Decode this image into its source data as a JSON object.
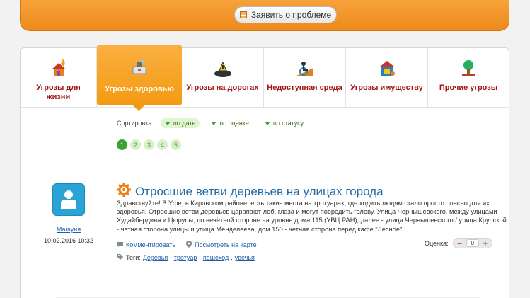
{
  "header": {
    "report_button": "Заявить о проблеме"
  },
  "tabs": [
    {
      "label": "Угрозы для жизни",
      "icon": "fire-house-icon"
    },
    {
      "label": "Угрозы здоровью",
      "icon": "health-threat-icon",
      "active": true
    },
    {
      "label": "Угрозы на дорогах",
      "icon": "road-threat-icon"
    },
    {
      "label": "Недоступная среда",
      "icon": "wheelchair-ramp-icon"
    },
    {
      "label": "Угрозы имуществу",
      "icon": "property-threat-icon"
    },
    {
      "label": "Прочие угрозы",
      "icon": "tree-threat-icon"
    }
  ],
  "sort": {
    "label": "Сортировка:",
    "options": [
      "по дате",
      "по оценке",
      "по статусу"
    ],
    "active": "по дате"
  },
  "pager": {
    "pages": [
      "1",
      "2",
      "3",
      "4",
      "5"
    ],
    "current": "1"
  },
  "post": {
    "author": "Машуня",
    "date": "10.02.2016 10:32",
    "title": "Отросшие ветви деревьев на улицах города",
    "body": "Здравствуйте! В Уфе, в Кировском районе, есть такие места на тротуарах, где ходить людям стало просто опасно для их здоровья. Отросшие ветви деревьев царапают лоб, глаза и могут повредить голову. Улица Чернышевского, между улицами Худайбердина и Цюрупы, по нечётной стороне на уровне дома 115 (УВЦ РАН), далее - улица Чернышевского / улица Крупской - четная сторона улицы  и  улица Менделеева, дом 150 - четная сторона перед кафе \"Лесное\".",
    "comment_link": "Комментировать",
    "map_link": "Посмотреть на карте",
    "tags_label": "Теги:",
    "tags": [
      "Деревья",
      "тротуар",
      "пешеход",
      "увечья"
    ],
    "rating_label": "Оценка:",
    "rating_value": "0"
  },
  "colors": {
    "orange": "#f39a12",
    "tab_label": "#a31616",
    "link": "#1f6aa8",
    "green": "#3aa335",
    "avatar": "#2aa3d6"
  }
}
